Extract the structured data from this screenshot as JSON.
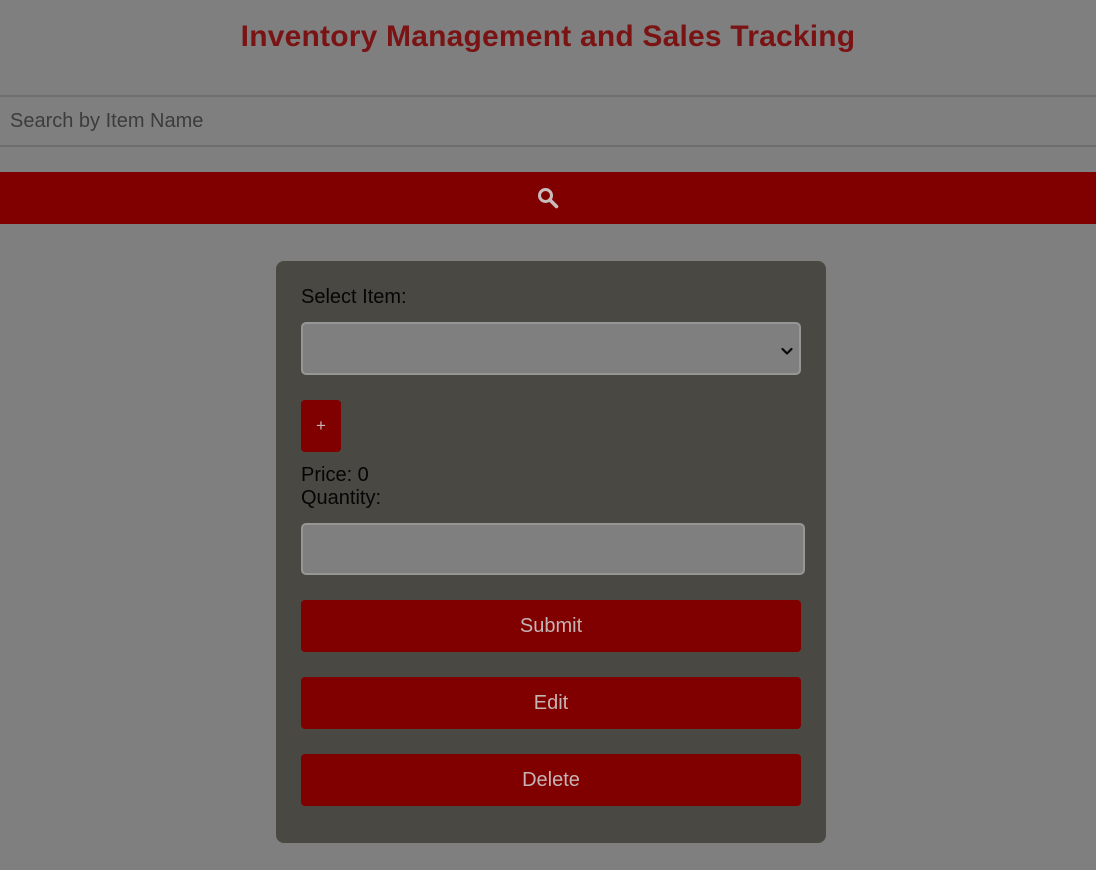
{
  "header": {
    "title": "Inventory Management and Sales Tracking"
  },
  "search": {
    "placeholder": "Search by Item Name",
    "value": "",
    "button_icon": "search-icon"
  },
  "form": {
    "select_label": "Select Item:",
    "selected_item": "",
    "add_label": "+",
    "price_label": "Price: 0",
    "quantity_label": "Quantity:",
    "quantity_value": "",
    "submit_label": "Submit",
    "edit_label": "Edit",
    "delete_label": "Delete"
  },
  "colors": {
    "accent": "#800000",
    "title": "#7a1414",
    "background": "#7f7f7f",
    "panel": "#4a4842"
  }
}
